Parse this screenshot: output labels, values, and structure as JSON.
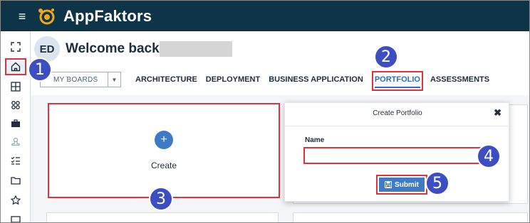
{
  "app": {
    "title": "AppFaktors",
    "brand_color": "#0e3447",
    "accent_color": "#3f7ac6",
    "highlight_color": "#e0323d"
  },
  "topbar": {
    "menu_icon": "hamburger-icon",
    "menu_glyph": "≡"
  },
  "sidebar": {
    "items": [
      {
        "name": "expand-icon"
      },
      {
        "name": "home-icon",
        "highlighted": true
      },
      {
        "name": "grid-icon"
      },
      {
        "name": "apps-icon"
      },
      {
        "name": "briefcase-icon"
      },
      {
        "name": "stamp-icon"
      },
      {
        "name": "checklist-icon"
      },
      {
        "name": "folder-icon"
      },
      {
        "name": "star-icon"
      },
      {
        "name": "monitor-icon"
      }
    ]
  },
  "header": {
    "avatar_initials": "ED",
    "welcome": "Welcome back,",
    "board_select": {
      "value": "MY BOARDS",
      "caret": "▼"
    },
    "tabs": [
      {
        "label": "ARCHITECTURE"
      },
      {
        "label": "DEPLOYMENT"
      },
      {
        "label": "BUSINESS APPLICATION"
      },
      {
        "label": "PORTFOLIO",
        "active": true
      },
      {
        "label": "ASSESSMENTS"
      }
    ]
  },
  "create_card": {
    "plus": "+",
    "label": "Create"
  },
  "modal": {
    "title": "Create Portfolio",
    "close": "✖",
    "name_label": "Name",
    "name_value": "",
    "submit_label": "Submit"
  },
  "steps": [
    "1",
    "2",
    "3",
    "4",
    "5"
  ]
}
